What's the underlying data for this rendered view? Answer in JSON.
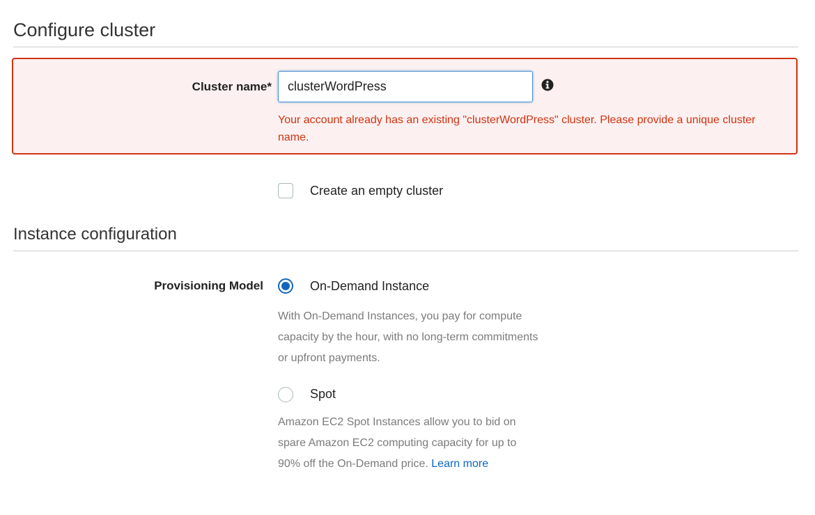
{
  "configure_cluster": {
    "title": "Configure cluster",
    "cluster_name": {
      "label": "Cluster name*",
      "value": "clusterWordPress",
      "info_icon": "info-circle-icon",
      "error": "Your account already has an existing \"clusterWordPress\" cluster. Please provide a unique cluster name."
    },
    "empty_cluster": {
      "label": "Create an empty cluster",
      "checked": false
    }
  },
  "instance_configuration": {
    "title": "Instance configuration",
    "provisioning_model": {
      "label": "Provisioning Model",
      "options": [
        {
          "label": "On-Demand Instance",
          "selected": true,
          "description": "With On-Demand Instances, you pay for compute capacity by the hour, with no long-term commitments or upfront payments."
        },
        {
          "label": "Spot",
          "selected": false,
          "description": "Amazon EC2 Spot Instances allow you to bid on spare Amazon EC2 computing capacity for up to 90% off the On-Demand price.",
          "link_text": "Learn more"
        }
      ]
    }
  },
  "colors": {
    "error": "#d13212",
    "error_bg": "#fcf1f0",
    "accent": "#1166bb",
    "link": "#0a66c2"
  }
}
